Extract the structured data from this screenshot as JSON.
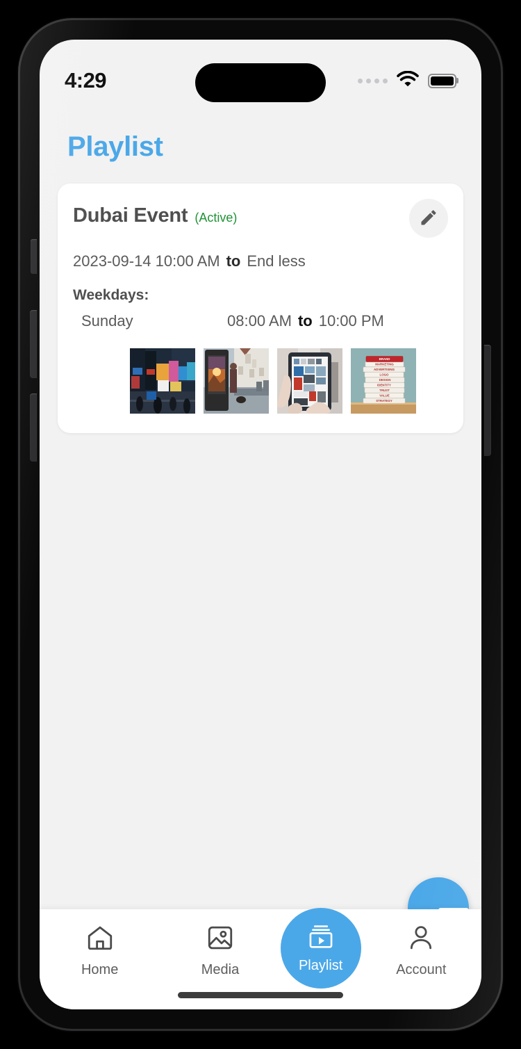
{
  "status_bar": {
    "time": "4:29",
    "signal_icon": "signal-dots-icon",
    "wifi_icon": "wifi-icon",
    "battery_icon": "battery-full-icon"
  },
  "header": {
    "title": "Playlist",
    "title_color": "#4ba8e8"
  },
  "playlist_card": {
    "event_name": "Dubai Event",
    "status": "(Active)",
    "status_color": "#1f9235",
    "start_datetime": "2023-09-14 10:00 AM",
    "range_separator": "to",
    "end_datetime": "End less",
    "weekdays_label": "Weekdays:",
    "schedule": [
      {
        "day": "Sunday",
        "start_time": "08:00 AM",
        "separator": "to",
        "end_time": "10:00 PM"
      }
    ],
    "edit_icon": "pencil-edit-icon",
    "thumbnails": [
      {
        "name": "times-square-billboards-thumbnail",
        "alt": "Times Square billboards at dusk"
      },
      {
        "name": "street-digital-signage-thumbnail",
        "alt": "Outdoor digital signage kiosk with sunset ad"
      },
      {
        "name": "tablet-in-hands-thumbnail",
        "alt": "Hands holding tablet showing content grid"
      },
      {
        "name": "brand-books-stack-thumbnail",
        "alt": "Stack of books labeled with brand terms",
        "book_labels": [
          "BRAND",
          "MARKETING",
          "ADVERTISING",
          "LOGO",
          "DESIGN",
          "IDENTITY",
          "TRUST",
          "VALUE",
          "STRATEGY"
        ]
      }
    ]
  },
  "fab": {
    "icon": "plus-icon",
    "color": "#4ba8e8"
  },
  "bottom_nav": {
    "active_color": "#4ba8e8",
    "items": [
      {
        "label": "Home",
        "icon": "home-icon",
        "active": false
      },
      {
        "label": "Media",
        "icon": "image-icon",
        "active": false
      },
      {
        "label": "Playlist",
        "icon": "playlist-play-icon",
        "active": true
      },
      {
        "label": "Account",
        "icon": "person-icon",
        "active": false
      }
    ]
  }
}
